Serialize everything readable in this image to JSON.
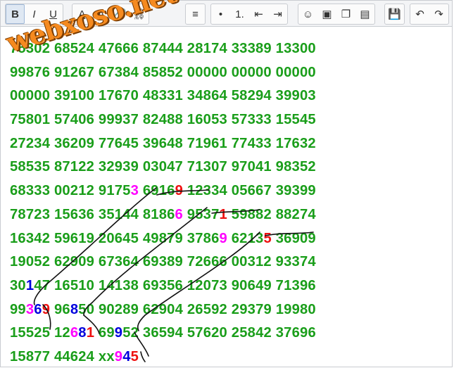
{
  "toolbar": {
    "groups": [
      [
        {
          "name": "bold-button",
          "label": "B",
          "active": true
        },
        {
          "name": "italic-button",
          "label": "I"
        },
        {
          "name": "underline-button",
          "label": "U"
        }
      ],
      [
        {
          "name": "font-color-button",
          "label": "A"
        },
        {
          "name": "font-size-button",
          "label": "A"
        },
        {
          "name": "link-button",
          "label": "🔗"
        },
        {
          "name": "unlink-button",
          "label": "⛓"
        }
      ],
      [
        {
          "name": "align-left-button",
          "label": "≡"
        }
      ],
      [
        {
          "name": "bullet-list-button",
          "label": "•"
        },
        {
          "name": "numbered-list-button",
          "label": "1."
        },
        {
          "name": "outdent-button",
          "label": "⇤"
        },
        {
          "name": "indent-button",
          "label": "⇥"
        }
      ],
      [
        {
          "name": "emoji-button",
          "label": "☺"
        },
        {
          "name": "image-button",
          "label": "▣"
        },
        {
          "name": "gallery-button",
          "label": "❐"
        },
        {
          "name": "paste-button",
          "label": "▤"
        }
      ],
      [
        {
          "name": "save-button",
          "label": "💾"
        }
      ],
      [
        {
          "name": "undo-button",
          "label": "↶"
        },
        {
          "name": "redo-button",
          "label": "↷"
        }
      ]
    ]
  },
  "watermark": "webxoso.net",
  "lines": [
    [
      {
        "t": "75302 68524 47666 87444 28174 33389 13300"
      }
    ],
    [
      {
        "t": "99876 91267 67384 85852 00000 00000 00000"
      }
    ],
    [
      {
        "t": "00000 39100 17670 48331 34864 58294 39903"
      }
    ],
    [
      {
        "t": "75801 57406 99937 82488 16053 57333 15545"
      }
    ],
    [
      {
        "t": "27234 36209 77645 39648 71961 77433 17632"
      }
    ],
    [
      {
        "t": "58535 87122 32939 03047 71307 97041 98352"
      }
    ],
    [
      {
        "t": "68333 00212 9175"
      },
      {
        "t": "3",
        "c": "m"
      },
      {
        "t": " 6916"
      },
      {
        "t": "9",
        "c": "r"
      },
      {
        "t": " 12334 05667 39399"
      }
    ],
    [
      {
        "t": "78723 15636 35144 8186"
      },
      {
        "t": "6",
        "c": "m"
      },
      {
        "t": " 9537"
      },
      {
        "t": "1",
        "c": "r"
      },
      {
        "t": " 59882 88274"
      }
    ],
    [
      {
        "t": "16342 59619 20645 49879 3786"
      },
      {
        "t": "9",
        "c": "m"
      },
      {
        "t": " 6213"
      },
      {
        "t": "5",
        "c": "r"
      },
      {
        "t": " 36909"
      }
    ],
    [
      {
        "t": "19052 62909 67364 69389 72666 00312 93374"
      }
    ],
    [
      {
        "t": "30"
      },
      {
        "t": "1",
        "c": "b"
      },
      {
        "t": "47 16510 14138 69356 12073 90649 71396"
      }
    ],
    [
      {
        "t": "99"
      },
      {
        "t": "3",
        "c": "m"
      },
      {
        "t": "6",
        "c": "b"
      },
      {
        "t": "9",
        "c": "r"
      },
      {
        "t": " 96"
      },
      {
        "t": "8",
        "c": "b"
      },
      {
        "t": "50 90289 62904 26592 29379 19980"
      }
    ],
    [
      {
        "t": "15525 12"
      },
      {
        "t": "6",
        "c": "m"
      },
      {
        "t": "8",
        "c": "b"
      },
      {
        "t": "1",
        "c": "r"
      },
      {
        "t": " 69"
      },
      {
        "t": "9",
        "c": "b"
      },
      {
        "t": "52 36594 57620 25842 37696"
      }
    ],
    [
      {
        "t": "15877 44624 xx"
      },
      {
        "t": "9",
        "c": "m"
      },
      {
        "t": "4",
        "c": "b"
      },
      {
        "t": "5",
        "c": "r"
      }
    ]
  ]
}
